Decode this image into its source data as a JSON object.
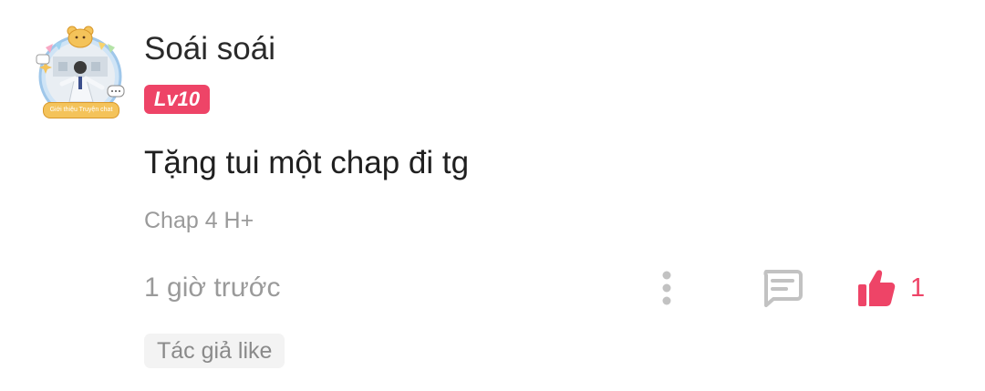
{
  "comment": {
    "avatar_caption": "Giới thiệu Truyện chat",
    "username": "Soái soái",
    "level": "Lv10",
    "content": "Tặng tui một chap đi tg",
    "chapter": "Chap 4 H+",
    "time": "1 giờ trước",
    "like_count": "1",
    "author_like_tag": "Tác giả like"
  },
  "actions": {
    "more_icon": "more-vertical-icon",
    "reply_icon": "comment-reply-icon",
    "like_icon": "thumbs-up-icon"
  },
  "colors": {
    "accent": "#ee4467",
    "muted": "#9a9a9a",
    "text": "#202020",
    "tag_bg": "#f3f3f3"
  }
}
